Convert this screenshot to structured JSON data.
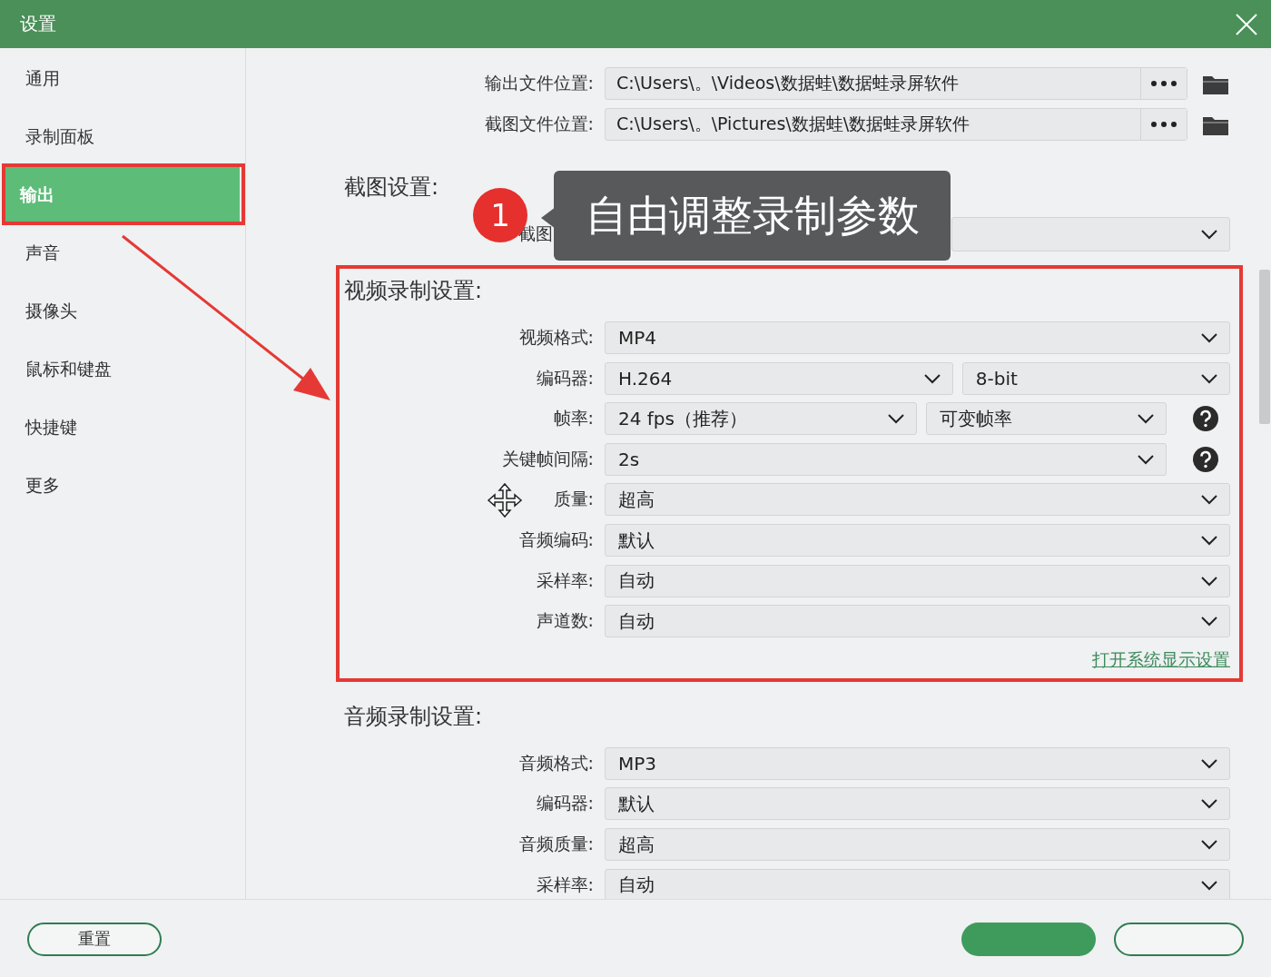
{
  "window": {
    "title": "设置"
  },
  "sidebar": {
    "items": [
      {
        "label": "通用",
        "selected": false
      },
      {
        "label": "录制面板",
        "selected": false
      },
      {
        "label": "输出",
        "selected": true
      },
      {
        "label": "声音",
        "selected": false
      },
      {
        "label": "摄像头",
        "selected": false
      },
      {
        "label": "鼠标和键盘",
        "selected": false
      },
      {
        "label": "快捷键",
        "selected": false
      },
      {
        "label": "更多",
        "selected": false
      }
    ]
  },
  "paths": [
    {
      "label": "输出文件位置:",
      "value": "C:\\Users\\。\\Videos\\数据蛙\\数据蛙录屏软件"
    },
    {
      "label": "截图文件位置:",
      "value": "C:\\Users\\。\\Pictures\\数据蛙\\数据蛙录屏软件"
    }
  ],
  "screenshot_settings": {
    "heading": "截图设置:",
    "rows": [
      {
        "label": "截图",
        "help": false,
        "fields": []
      }
    ]
  },
  "video_settings": {
    "heading": "视频录制设置:",
    "link": "打开系统显示设置",
    "rows": [
      {
        "label": "视频格式:",
        "help": false,
        "fields": [
          "MP4"
        ]
      },
      {
        "label": "编码器:",
        "help": false,
        "fields": [
          "H.264",
          "8-bit"
        ]
      },
      {
        "label": "帧率:",
        "help": true,
        "fields": [
          "24 fps（推荐）",
          "可变帧率"
        ]
      },
      {
        "label": "关键帧间隔:",
        "help": true,
        "fields": [
          "2s"
        ]
      },
      {
        "label": "质量:",
        "help": false,
        "fields": [
          "超高"
        ]
      },
      {
        "label": "音频编码:",
        "help": false,
        "fields": [
          "默认"
        ]
      },
      {
        "label": "采样率:",
        "help": false,
        "fields": [
          "自动"
        ]
      },
      {
        "label": "声道数:",
        "help": false,
        "fields": [
          "自动"
        ]
      }
    ]
  },
  "audio_settings": {
    "heading": "音频录制设置:",
    "rows": [
      {
        "label": "音频格式:",
        "help": false,
        "fields": [
          "MP3"
        ]
      },
      {
        "label": "编码器:",
        "help": false,
        "fields": [
          "默认"
        ]
      },
      {
        "label": "音频质量:",
        "help": false,
        "fields": [
          "超高"
        ]
      },
      {
        "label": "采样率:",
        "help": false,
        "fields": [
          "自动"
        ]
      }
    ]
  },
  "annotation": {
    "number": "1",
    "text": "自由调整录制参数"
  },
  "footer": {
    "reset": "重置",
    "buttons": [
      {
        "kind": "primary"
      },
      {
        "kind": "outline"
      }
    ]
  }
}
